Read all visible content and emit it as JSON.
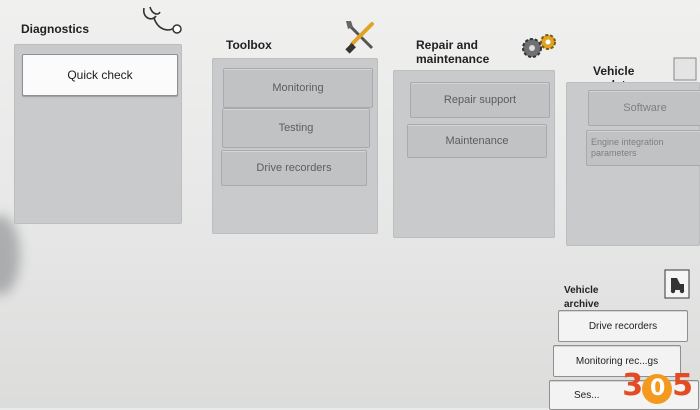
{
  "diagnostics": {
    "title": "Diagnostics",
    "buttons": [
      "Quick check"
    ]
  },
  "toolbox": {
    "title": "Toolbox",
    "buttons": [
      "Monitoring",
      "Testing",
      "Drive recorders"
    ]
  },
  "repair": {
    "title": "Repair and maintenance",
    "buttons": [
      "Repair support",
      "Maintenance"
    ]
  },
  "vehicle_update": {
    "title": "Vehicle update",
    "buttons": [
      "Software",
      "Engine integration parameters"
    ]
  },
  "vehicle_archive": {
    "title": "Vehicle archive",
    "buttons": [
      "Drive recorders",
      "Monitoring rec...gs",
      "Ses..."
    ]
  },
  "watermark": [
    "3",
    "0",
    "5"
  ],
  "colors": {
    "panel": "#c9cacb",
    "background": "#e9eaea",
    "button_disabled_text": "#5c5d5e",
    "watermark_orange": "#f39a1e",
    "watermark_red": "#e44b22"
  },
  "icons": {
    "diagnostics": "stethoscope-icon",
    "toolbox": "tools-icon",
    "repair": "gears-icon",
    "vehicle_update": "update-icon",
    "vehicle_archive": "archive-icon"
  }
}
